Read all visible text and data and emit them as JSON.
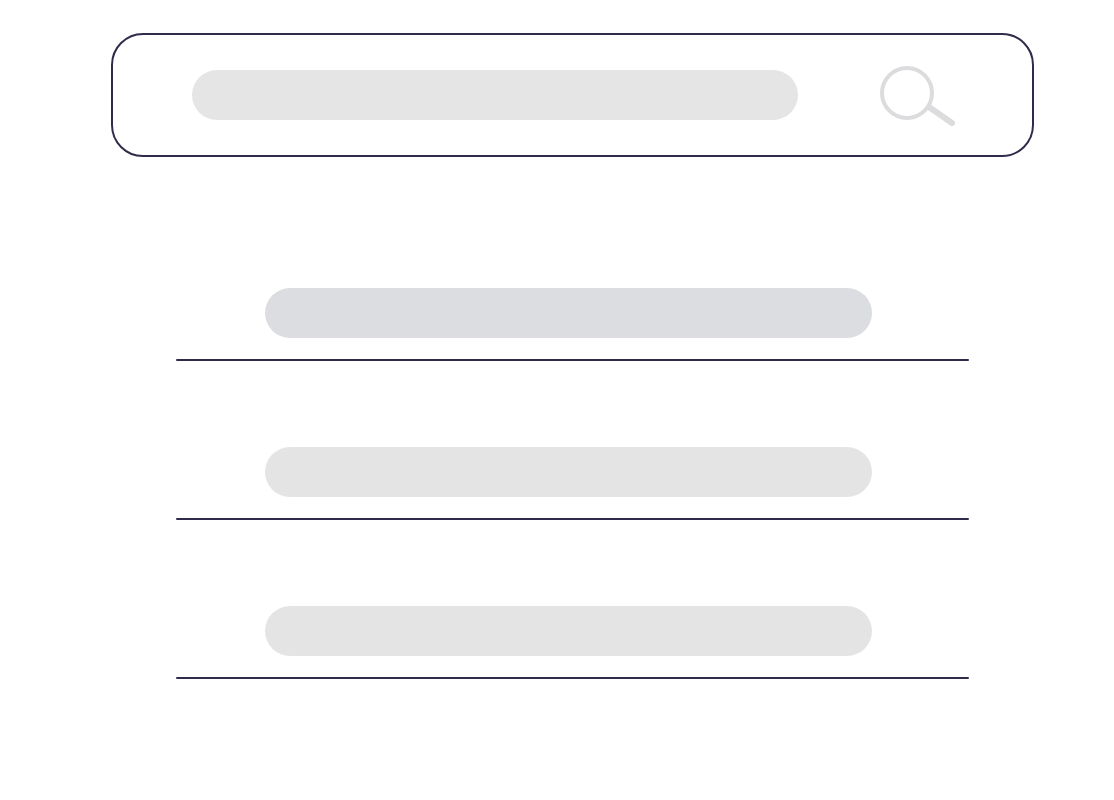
{
  "results": [
    {
      "color": "#dcdde0"
    },
    {
      "color": "#e4e4e4"
    },
    {
      "color": "#e4e4e4"
    }
  ]
}
